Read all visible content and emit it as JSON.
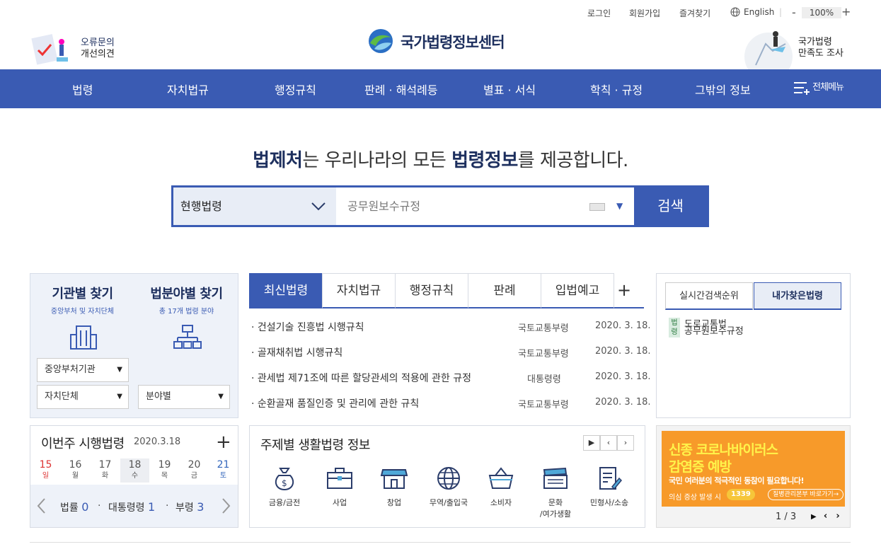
{
  "util": {
    "login": "로그인",
    "join": "회원가입",
    "favorites": "즐겨찾기",
    "english": "English",
    "zoom_minus": "-",
    "zoom": "100%",
    "zoom_plus": "+"
  },
  "header": {
    "logo": "국가법령정보센터",
    "left_banner": [
      "오류문의",
      "개선의견"
    ],
    "right_banner": [
      "국가법령",
      "만족도 조사"
    ]
  },
  "nav": {
    "items": [
      "법령",
      "자치법규",
      "행정규칙",
      "판례 · 해석례등",
      "별표 · 서식",
      "학칙 · 규정",
      "그밖의 정보"
    ],
    "all_menu": "전체메뉴"
  },
  "hero": {
    "pre": "법제처",
    "mid": "는 우리나라의 모든 ",
    "bold": "법령정보",
    "post": "를 제공합니다."
  },
  "search": {
    "scope": "현행법령",
    "query": "공무원보수규정",
    "button": "검색"
  },
  "finder": {
    "org_title": "기관별 찾기",
    "org_sub": "중앙부처 및 자치단체",
    "field_title": "법분야별 찾기",
    "field_sub": "총 17개 법령 분야",
    "dd_central": "중앙부처기관",
    "dd_local": "자치단체",
    "dd_field": "분야별"
  },
  "tabs": {
    "items": [
      "최신법령",
      "자치법규",
      "행정규칙",
      "판례",
      "입법예고"
    ],
    "plus": "+"
  },
  "laws": [
    {
      "title": "· 건설기술 진흥법 시행규칙",
      "org": "국토교통부령",
      "date": "2020. 3. 18."
    },
    {
      "title": "· 골재채취법 시행규칙",
      "org": "국토교통부령",
      "date": "2020. 3. 18."
    },
    {
      "title": "· 관세법 제71조에 따른 할당관세의 적용에 관한 규정",
      "org": "대통령령",
      "date": "2020. 3. 18."
    },
    {
      "title": "· 순환골재 품질인증 및 관리에 관한 규칙",
      "org": "국토교통부령",
      "date": "2020. 3. 18."
    }
  ],
  "rank": {
    "tab_realtime": "실시간검색순위",
    "tab_mine": "내가찾은법령",
    "tag": "법령",
    "entry1": "도로교통법",
    "entry2": "공무원보수규정"
  },
  "week": {
    "title": "이번주 시행법령",
    "date": "2020.3.18",
    "plus": "+",
    "days": [
      {
        "n": "15",
        "w": "일"
      },
      {
        "n": "16",
        "w": "월"
      },
      {
        "n": "17",
        "w": "화"
      },
      {
        "n": "18",
        "w": "수"
      },
      {
        "n": "19",
        "w": "목"
      },
      {
        "n": "20",
        "w": "금"
      },
      {
        "n": "21",
        "w": "토"
      }
    ],
    "law_label": "법률",
    "law_count": "0",
    "decree_label": "대통령령",
    "decree_count": "1",
    "ministry_label": "부령",
    "ministry_count": "3"
  },
  "topic": {
    "title": "주제별 생활법령 정보",
    "items": [
      "금융/금전",
      "사업",
      "창업",
      "무역/출입국",
      "소비자",
      "문화\n/여가생활",
      "민형사/소송"
    ]
  },
  "covid": {
    "line1": "신종 코로나바이러스",
    "line2": "감염증 예방",
    "line3": "국민 여러분의 적극적인 동참이 필요합니다!",
    "line4": "의심 증상 발생 시",
    "phone": "1339",
    "link": "질병관리본부 바로가기→",
    "page": "1 / 3"
  },
  "colors": {
    "primary": "#3a5bb3",
    "navy": "#1d2f5e",
    "covid": "#f79a2a"
  }
}
